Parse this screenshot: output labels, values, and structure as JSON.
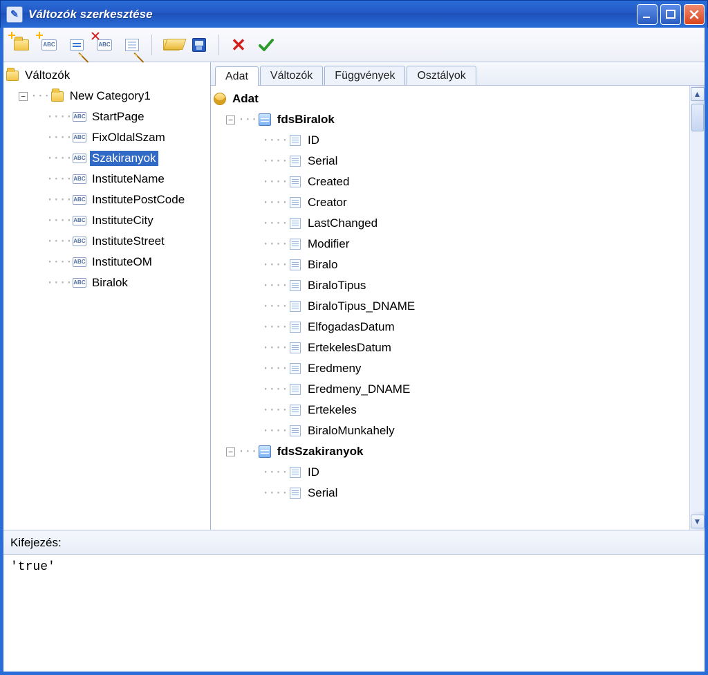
{
  "window": {
    "title": "Változók szerkesztése"
  },
  "toolbar": {
    "btn_new_folder": "new-category",
    "btn_new_var": "new-variable",
    "btn_edit_card": "edit",
    "btn_delete_var": "delete-variable",
    "btn_edit_note": "edit-note",
    "btn_open": "open",
    "btn_save": "save",
    "btn_cancel": "cancel",
    "btn_ok": "ok"
  },
  "leftTree": {
    "root": "Változók",
    "category": "New Category1",
    "items": [
      "StartPage",
      "FixOldalSzam",
      "Szakiranyok",
      "InstituteName",
      "InstitutePostCode",
      "InstituteCity",
      "InstituteStreet",
      "InstituteOM",
      "Biralok"
    ],
    "selectedIndex": 2
  },
  "tabs": {
    "items": [
      "Adat",
      "Változók",
      "Függvények",
      "Osztályok"
    ],
    "activeIndex": 0
  },
  "rightTree": {
    "root": "Adat",
    "tables": [
      {
        "name": "fdsBiralok",
        "fields": [
          "ID",
          "Serial",
          "Created",
          "Creator",
          "LastChanged",
          "Modifier",
          "Biralo",
          "BiraloTipus",
          "BiraloTipus_DNAME",
          "ElfogadasDatum",
          "ErtekelesDatum",
          "Eredmeny",
          "Eredmeny_DNAME",
          "Ertekeles",
          "BiraloMunkahely"
        ]
      },
      {
        "name": "fdsSzakiranyok",
        "fields": [
          "ID",
          "Serial"
        ]
      }
    ]
  },
  "expression": {
    "label": "Kifejezés:",
    "value": "'true'"
  }
}
